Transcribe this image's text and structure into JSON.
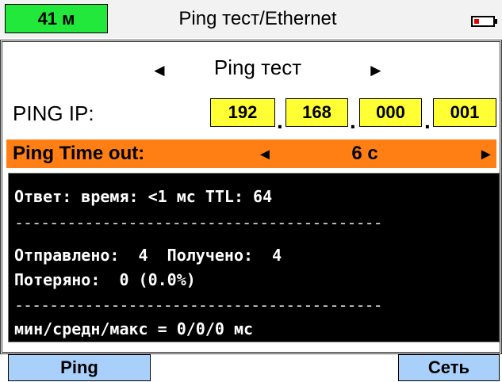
{
  "header": {
    "timer": "41 м",
    "title": "Ping тест/Ethernet"
  },
  "mode": {
    "left_arrow": "◄",
    "label": "Ping тест",
    "right_arrow": "►"
  },
  "ping_ip": {
    "label": "PING IP:",
    "octets": [
      "192",
      "168",
      "000",
      "001"
    ],
    "separator": "."
  },
  "timeout": {
    "label": "Ping Time out:",
    "left_arrow": "◄",
    "value": "6 с",
    "right_arrow": "►"
  },
  "console": {
    "lines": [
      "Ответ: время: <1 мс TTL: 64",
      "------------------------------------------",
      "Отправлено:  4  Получено:  4",
      "Потеряно:  0 (0.0%)",
      "------------------------------------------",
      "мин/средн/макс = 0/0/0 мс"
    ]
  },
  "softkeys": {
    "ping": "Ping",
    "network": "Сеть"
  },
  "colors": {
    "timer_bg": "#22e83b",
    "octet_bg": "#ffff33",
    "timeout_bg": "#ff7f14",
    "softkey_bg": "#a9d0fb",
    "console_bg": "#000000",
    "battery_level": "#e00000"
  },
  "icons": {
    "battery": "battery-low-icon"
  }
}
